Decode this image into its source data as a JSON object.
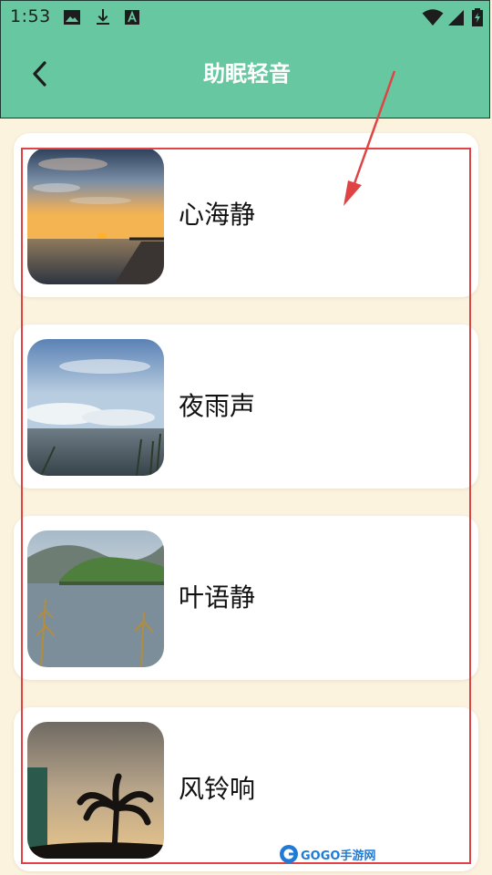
{
  "status_bar": {
    "time": "1:53",
    "icons": [
      "image-icon",
      "download-icon",
      "a-box-icon",
      "wifi-icon",
      "signal-icon",
      "battery-charging-icon"
    ]
  },
  "header": {
    "title": "助眠轻音",
    "back_icon": "chevron-left-icon",
    "background_color": "#67c7a1"
  },
  "items": [
    {
      "label": "心海静",
      "thumb": "sunset-pier-photo"
    },
    {
      "label": "夜雨声",
      "thumb": "cloudy-lake-photo"
    },
    {
      "label": "叶语静",
      "thumb": "island-trees-photo"
    },
    {
      "label": "风铃响",
      "thumb": "palm-dusk-photo"
    }
  ],
  "annotation": {
    "frame_color": "#e04343",
    "arrow_color": "#e04343"
  },
  "watermark": {
    "text": "GOGO手游网"
  }
}
